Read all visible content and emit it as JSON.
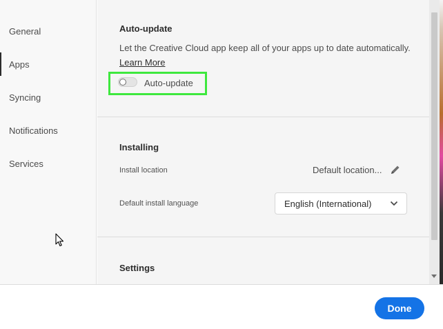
{
  "sidebar": {
    "items": [
      {
        "label": "General",
        "active": false
      },
      {
        "label": "Apps",
        "active": true
      },
      {
        "label": "Syncing",
        "active": false
      },
      {
        "label": "Notifications",
        "active": false
      },
      {
        "label": "Services",
        "active": false
      }
    ]
  },
  "auto_update": {
    "title": "Auto-update",
    "description": "Let the Creative Cloud app keep all of your apps up to date automatically.",
    "learn_more": "Learn More",
    "toggle_label": "Auto-update",
    "toggle_on": false,
    "highlight_color": "#3ee83e"
  },
  "installing": {
    "title": "Installing",
    "location_label": "Install location",
    "location_value": "Default location...",
    "language_label": "Default install language",
    "language_value": "English (International)"
  },
  "settings": {
    "title": "Settings"
  },
  "footer": {
    "done_label": "Done",
    "accent": "#1473e6"
  }
}
